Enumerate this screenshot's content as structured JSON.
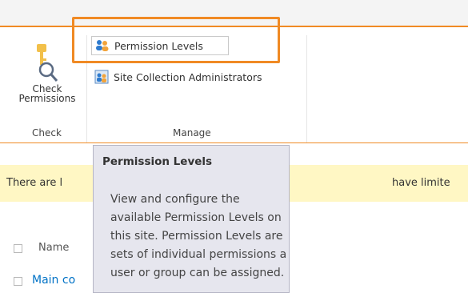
{
  "ribbon": {
    "check_group": {
      "button_label_line1": "Check",
      "button_label_line2": "Permissions",
      "group_label": "Check",
      "icon": "key-magnifier-icon"
    },
    "manage_group": {
      "permission_levels_label": "Permission Levels",
      "permission_levels_icon": "people-group-icon",
      "site_collection_admins_label": "Site Collection Administrators",
      "site_collection_admins_icon": "admin-people-icon",
      "group_label": "Manage"
    }
  },
  "notice": {
    "text_left": "There are l",
    "text_right": "have limite"
  },
  "list": {
    "column_name": "Name",
    "rows": [
      {
        "name": "Main co"
      }
    ]
  },
  "tooltip": {
    "title": "Permission Levels",
    "body": "View and configure the available Permission Levels on this site. Permission Levels are sets of individual permissions a user or group can be assigned."
  },
  "colors": {
    "accent_orange": "#f08a24",
    "link_blue": "#0072c6",
    "notice_yellow": "#fff7c4",
    "tooltip_bg": "#e6e6ee"
  }
}
